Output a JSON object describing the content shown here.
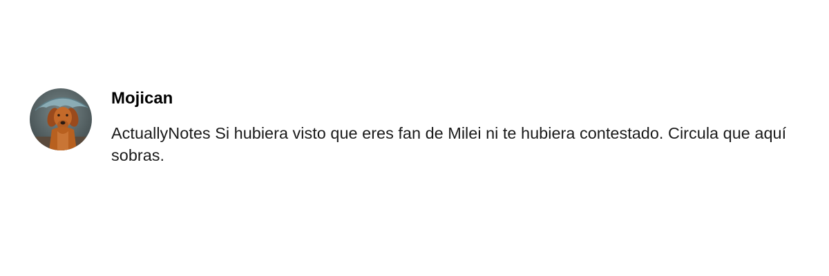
{
  "comment": {
    "avatar_icon": "dog-avatar-icon",
    "author": "Mojican",
    "text": "ActuallyNotes Si hubiera visto que eres fan de Milei ni te hubiera contestado. Circula que aquí sobras."
  }
}
